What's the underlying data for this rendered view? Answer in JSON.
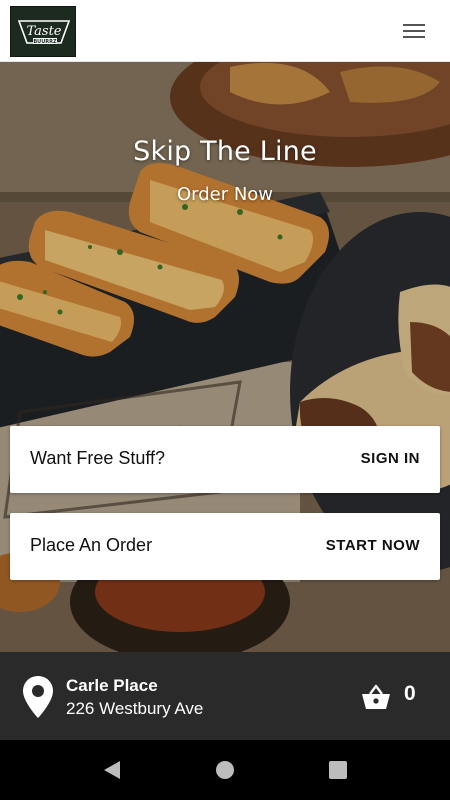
{
  "header": {
    "logo_line1": "Taste",
    "logo_line2": "BUURRZ",
    "menu_icon": "hamburger-menu-icon"
  },
  "hero": {
    "title": "Skip The Line",
    "cta_label": "Order Now"
  },
  "cards": [
    {
      "title": "Want Free Stuff?",
      "action": "SIGN IN"
    },
    {
      "title": "Place An Order",
      "action": "START NOW"
    }
  ],
  "location": {
    "icon": "map-pin-icon",
    "name": "Carle Place",
    "address": "226 Westbury Ave"
  },
  "cart": {
    "icon": "shopping-basket-icon",
    "count": "0"
  },
  "navbar": {
    "back_icon": "back-triangle-icon",
    "home_icon": "home-circle-icon",
    "recents_icon": "recents-square-icon"
  },
  "colors": {
    "header_bg": "#ffffff",
    "logo_bg": "#1d2a20",
    "location_bar_bg": "#2a2a2a",
    "navbar_bg": "#000000"
  }
}
